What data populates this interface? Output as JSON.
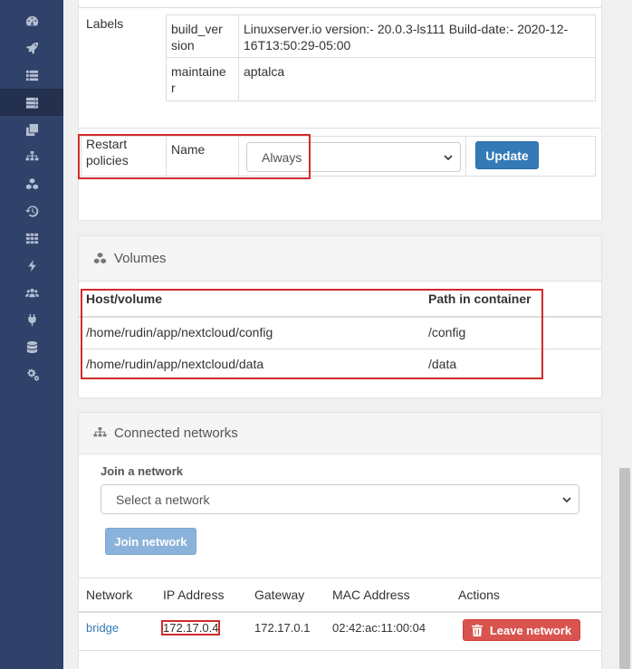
{
  "sidebar": {
    "icons": [
      "dashboard-icon",
      "rocket-icon",
      "list-icon",
      "server-icon",
      "clone-icon",
      "sitemap-icon",
      "cubes-icon",
      "history-icon",
      "grid-icon",
      "bolt-icon",
      "users-icon",
      "plug-icon",
      "database-icon",
      "cogs-icon"
    ],
    "active_index": 3
  },
  "labels_section": {
    "title": "Labels",
    "rows": [
      {
        "key": "build_version",
        "key_line1": "build_ver",
        "key_line2": "sion",
        "value_line1": "Linuxserver.io version:- 20.0.3-ls111 Build-date:- 2020-12-",
        "value_line2": "16T13:50:29-05:00"
      },
      {
        "key": "maintainer",
        "key_line1": "maintaine",
        "key_line2": "r",
        "value_line1": "aptalca",
        "value_line2": ""
      }
    ]
  },
  "restart_policies": {
    "label_line1": "Restart",
    "label_line2": "policies",
    "name_label": "Name",
    "selected": "Always",
    "update_label": "Update"
  },
  "volumes": {
    "title": "Volumes",
    "col_host": "Host/volume",
    "col_path": "Path in container",
    "rows": [
      {
        "host": "/home/rudin/app/nextcloud/config",
        "path": "/config"
      },
      {
        "host": "/home/rudin/app/nextcloud/data",
        "path": "/data"
      }
    ]
  },
  "networks": {
    "title": "Connected networks",
    "join_label": "Join a network",
    "select_placeholder": "Select a network",
    "join_button": "Join network",
    "columns": [
      "Network",
      "IP Address",
      "Gateway",
      "MAC Address",
      "Actions"
    ],
    "rows": [
      {
        "network": "bridge",
        "ip": "172.17.0.4",
        "gateway": "172.17.0.1",
        "mac": "02:42:ac:11:00:04",
        "action": "Leave network"
      }
    ]
  },
  "colors": {
    "sidebar": "#30426a",
    "primary": "#337ab7",
    "danger": "#d9534f",
    "highlight": "#d22b2b"
  }
}
